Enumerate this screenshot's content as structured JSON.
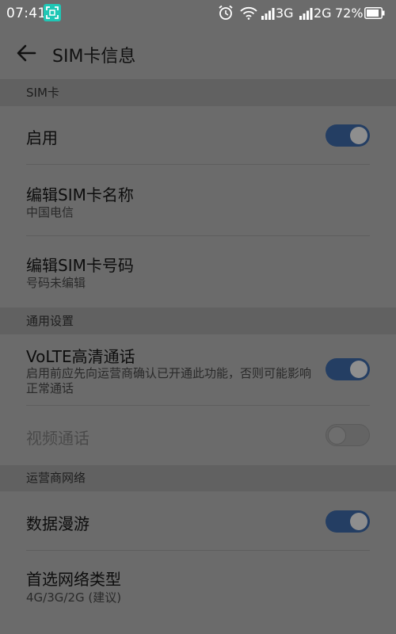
{
  "status_bar": {
    "time": "07:41",
    "network_1": "3G",
    "network_2": "2G",
    "battery": "72%"
  },
  "header": {
    "title": "SIM卡信息"
  },
  "sections": {
    "sim": "SIM卡",
    "general": "通用设置",
    "carrier": "运营商网络"
  },
  "rows": {
    "enable": {
      "title": "启用",
      "toggle": "on"
    },
    "edit_name": {
      "title": "编辑SIM卡名称",
      "subtitle": "中国电信"
    },
    "edit_number": {
      "title": "编辑SIM卡号码",
      "subtitle": "号码未编辑"
    },
    "volte": {
      "title": "VoLTE高清通话",
      "subtitle": "启用前应先向运营商确认已开通此功能，否则可能影响正常通话",
      "toggle": "on"
    },
    "video_call": {
      "title": "视频通话",
      "toggle": "off"
    },
    "data_roaming": {
      "title": "数据漫游",
      "toggle": "on"
    },
    "network_type": {
      "title": "首选网络类型",
      "subtitle": "4G/3G/2G (建议)"
    }
  },
  "colors": {
    "background": "#6b6b6b",
    "toggle_on": "#243e63",
    "scan_badge": "#1fc7b5"
  },
  "icons": [
    "scan-icon",
    "alarm-icon",
    "wifi-icon",
    "signal-icon",
    "battery-icon",
    "back-arrow-icon"
  ]
}
